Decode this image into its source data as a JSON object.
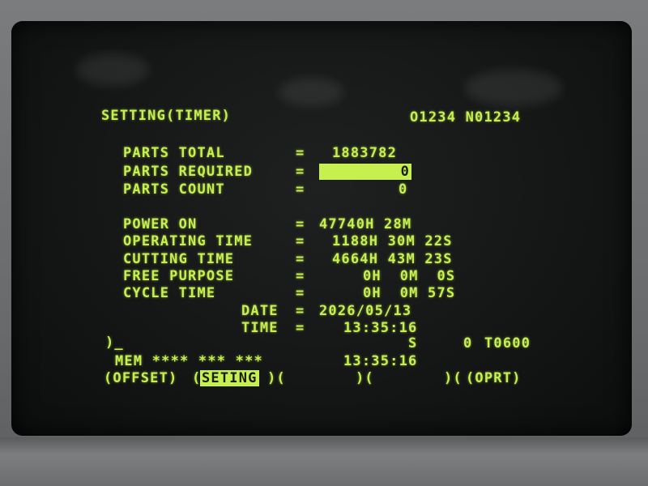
{
  "header": {
    "title": "SETTING(TIMER)",
    "program": "O1234 N01234"
  },
  "parts": [
    {
      "label": "PARTS TOTAL",
      "eq": "=",
      "value": "1883782"
    },
    {
      "label": "PARTS REQUIRED",
      "eq": "=",
      "value": "0"
    },
    {
      "label": "PARTS COUNT",
      "eq": "=",
      "value": "0"
    }
  ],
  "timers": [
    {
      "label": "POWER ON",
      "eq": "=",
      "value": "47740H 28M"
    },
    {
      "label": "OPERATING TIME",
      "eq": "=",
      "value": "1188H 30M 22S"
    },
    {
      "label": "CUTTING TIME",
      "eq": "=",
      "value": "4664H 43M 23S"
    },
    {
      "label": "FREE PURPOSE",
      "eq": "=",
      "value": "0H  0M  0S"
    },
    {
      "label": "CYCLE TIME",
      "eq": "=",
      "value": "0H  0M 57S"
    }
  ],
  "date": {
    "label": "DATE",
    "eq": "=",
    "value": "2026/05/13"
  },
  "time": {
    "label": "TIME",
    "eq": "=",
    "value": "13:35:16"
  },
  "input": {
    "prompt": ")_",
    "spindle": "S",
    "spindle_value": "0",
    "tool": "T0600"
  },
  "status": {
    "mode": "MEM **** *** ***",
    "clock": "13:35:16"
  },
  "softkeys": {
    "offset": "(OFFSET)",
    "setting_open": "(",
    "setting": "SETING",
    "setting_close": ")(",
    "blank1": ")(",
    "blank2": ")(",
    "oprt": "(OPRT)"
  }
}
